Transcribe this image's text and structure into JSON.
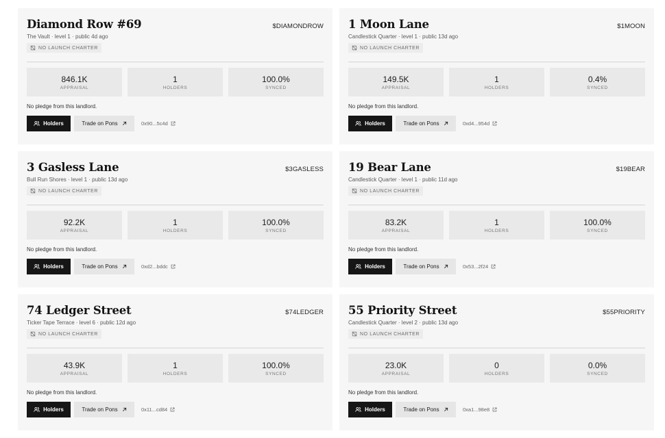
{
  "labels": {
    "badge": "NO LAUNCH CHARTER",
    "appraisal": "APPRAISAL",
    "holders": "HOLDERS",
    "synced": "SYNCED",
    "pledge": "No pledge from this landlord.",
    "holders_button": "Holders",
    "trade_button": "Trade on Pons"
  },
  "cards": [
    {
      "title": "Diamond Row #69",
      "ticker": "$DIAMONDROW",
      "subtitle": "The Vault · level 1 · public 4d ago",
      "appraisal": "846.1K",
      "holders": "1",
      "synced": "100.0%",
      "address": "0x90...5c4d"
    },
    {
      "title": "1 Moon Lane",
      "ticker": "$1MOON",
      "subtitle": "Candlestick Quarter · level 1 · public 13d ago",
      "appraisal": "149.5K",
      "holders": "1",
      "synced": "0.4%",
      "address": "0xd4...954d"
    },
    {
      "title": "3 Gasless Lane",
      "ticker": "$3GASLESS",
      "subtitle": "Bull Run Shores · level 1 · public 13d ago",
      "appraisal": "92.2K",
      "holders": "1",
      "synced": "100.0%",
      "address": "0xd2...bddc"
    },
    {
      "title": "19 Bear Lane",
      "ticker": "$19BEAR",
      "subtitle": "Candlestick Quarter · level 1 · public 11d ago",
      "appraisal": "83.2K",
      "holders": "1",
      "synced": "100.0%",
      "address": "0x53...2f24"
    },
    {
      "title": "74 Ledger Street",
      "ticker": "$74LEDGER",
      "subtitle": "Ticker Tape Terrace · level 6 · public 12d ago",
      "appraisal": "43.9K",
      "holders": "1",
      "synced": "100.0%",
      "address": "0x11...cd84"
    },
    {
      "title": "55 Priority Street",
      "ticker": "$55PRIORITY",
      "subtitle": "Candlestick Quarter · level 2 · public 13d ago",
      "appraisal": "23.0K",
      "holders": "0",
      "synced": "0.0%",
      "address": "0xa1...98e8"
    }
  ]
}
